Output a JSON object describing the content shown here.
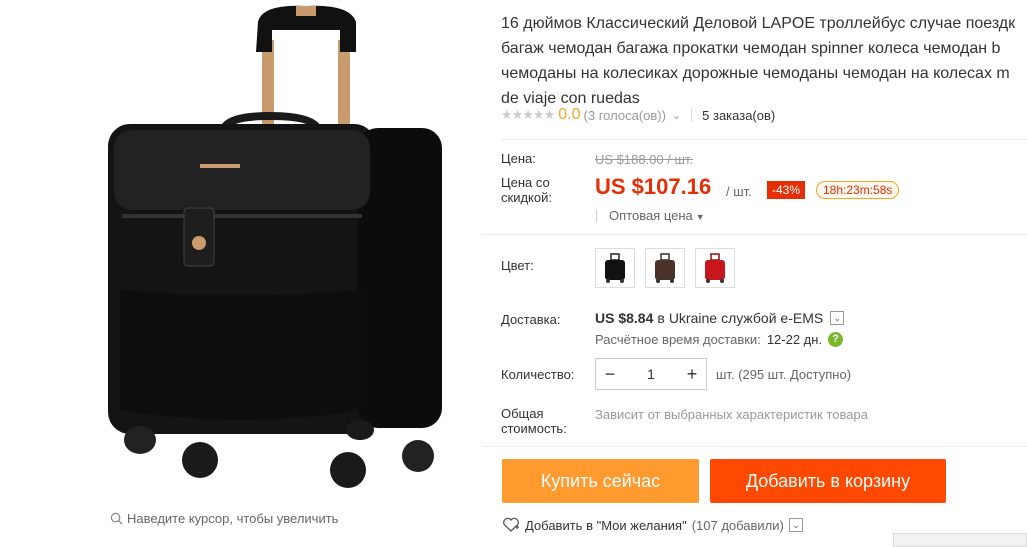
{
  "title_lines": [
    "16 дюймов Классический Деловой LAPOE троллейбус случае поездк",
    "багаж чемодан багажа прокатки чемодан spinner колеса чемодан b",
    "чемоданы на колесиках дорожные чемоданы чемодан на колесах m",
    "de viaje con ruedas"
  ],
  "rating": {
    "value": "0.0",
    "votes": "(3 голоса(ов))",
    "orders": "5 заказа(ов)"
  },
  "price": {
    "label_price": "Цена:",
    "old_price": "US $188.00 / шт.",
    "label_discount_price": "Цена со скидкой:",
    "new_price": "US $107.16",
    "unit": "/ шт.",
    "discount": "-43%",
    "timer": "18h:23m:58s",
    "wholesale": "Оптовая цена"
  },
  "color": {
    "label": "Цвет:",
    "options": [
      "black",
      "brown",
      "red"
    ]
  },
  "shipping": {
    "label": "Доставка:",
    "cost": "US $8.84",
    "in": "в",
    "country": "Ukraine",
    "service": "службой e-EMS",
    "estimate_label": "Расчётное время доставки:",
    "estimate_days": "12-22 дн."
  },
  "quantity": {
    "label": "Количество:",
    "value": "1",
    "note": "шт. (295 шт. Доступно)"
  },
  "total": {
    "label": "Общая стоимость:",
    "note": "Зависит от выбранных характеристик товара"
  },
  "buttons": {
    "buy": "Купить сейчас",
    "cart": "Добавить в корзину"
  },
  "wishlist": {
    "text": "Добавить в \"Мои желания\"",
    "count": "(107 добавили)"
  },
  "zoom_hint": "Наведите курсор, чтобы увеличить",
  "colors": {
    "accent": "#e62e04",
    "buy": "#ff9a2e",
    "cart": "#ff4800",
    "rating": "#f5a623"
  }
}
